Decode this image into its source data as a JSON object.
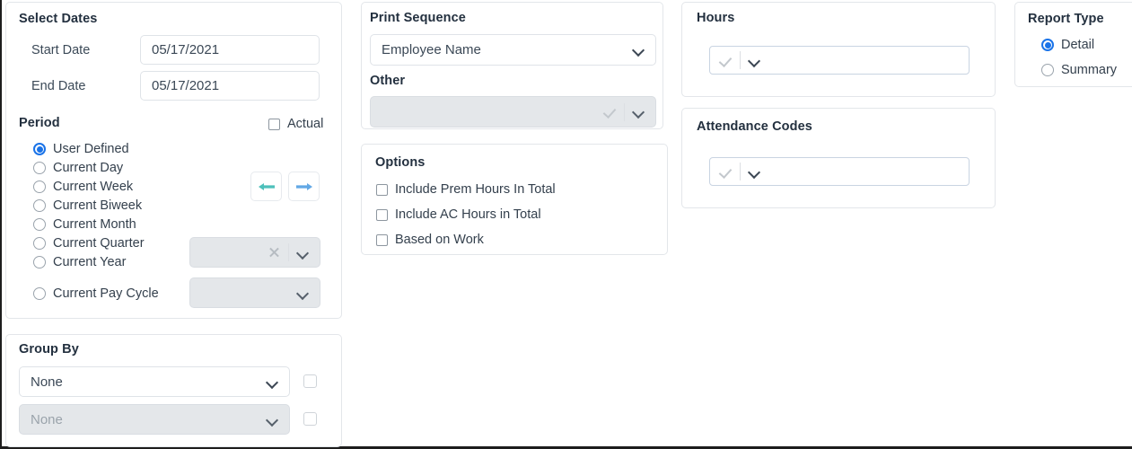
{
  "select_dates": {
    "title": "Select Dates",
    "start_date_label": "Start Date",
    "start_date_value": "05/17/2021",
    "end_date_label": "End Date",
    "end_date_value": "05/17/2021",
    "period_label": "Period",
    "actual_label": "Actual",
    "actual_checked": false,
    "period_options": [
      {
        "label": "User Defined",
        "checked": true
      },
      {
        "label": "Current Day",
        "checked": false
      },
      {
        "label": "Current Week",
        "checked": false
      },
      {
        "label": "Current Biweek",
        "checked": false
      },
      {
        "label": "Current Month",
        "checked": false
      },
      {
        "label": "Current Quarter",
        "checked": false
      },
      {
        "label": "Current Year",
        "checked": false
      },
      {
        "label": "Current Pay Cycle",
        "checked": false
      }
    ],
    "nav_prev_icon": "arrow-left-icon",
    "nav_next_icon": "arrow-right-icon",
    "nav_prev_color": "#4dc0bb",
    "nav_next_color": "#62a8e5",
    "period_select_value": "",
    "pay_cycle_select_value": ""
  },
  "group_by": {
    "title": "Group By",
    "first_value": "None",
    "second_value": "None",
    "first_checkbox_checked": false,
    "second_checkbox_checked": false
  },
  "print_sequence": {
    "title": "Print Sequence",
    "value": "Employee Name",
    "other_label": "Other",
    "other_value": ""
  },
  "options": {
    "title": "Options",
    "items": [
      {
        "label": "Include Prem Hours In Total",
        "checked": false
      },
      {
        "label": "Include AC Hours in Total",
        "checked": false
      },
      {
        "label": "Based on Work",
        "checked": false
      }
    ]
  },
  "hours": {
    "title": "Hours",
    "value": ""
  },
  "attendance_codes": {
    "title": "Attendance Codes",
    "value": ""
  },
  "report_type": {
    "title": "Report Type",
    "options": [
      {
        "label": "Detail",
        "checked": true
      },
      {
        "label": "Summary",
        "checked": false
      }
    ]
  },
  "theme": {
    "accent": "#1a73e8",
    "panel_border": "#e3e6ea",
    "disabled_bg": "#e4e7ea",
    "text": "#2b3a4a"
  }
}
